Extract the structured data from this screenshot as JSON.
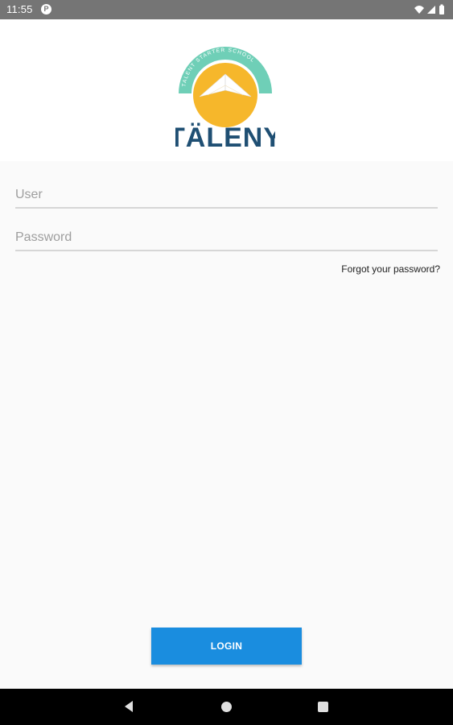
{
  "status_bar": {
    "time": "11:55",
    "notification_badge": "P",
    "icons": [
      "wifi-icon",
      "signal-icon",
      "battery-icon"
    ]
  },
  "logo": {
    "arc_text": "TALENT STARTER SCHOOL",
    "wordmark": "TÄLENY",
    "colors": {
      "arc": "#6fcfb7",
      "sun": "#f6b72b",
      "text": "#1f4f73"
    }
  },
  "form": {
    "user_placeholder": "User",
    "user_value": "",
    "password_placeholder": "Password",
    "password_value": "",
    "forgot_label": "Forgot your password?"
  },
  "login": {
    "label": "LOGIN",
    "color": "#1a8ddf"
  },
  "nav_bar": {
    "buttons": [
      "back-icon",
      "home-icon",
      "recents-icon"
    ]
  }
}
